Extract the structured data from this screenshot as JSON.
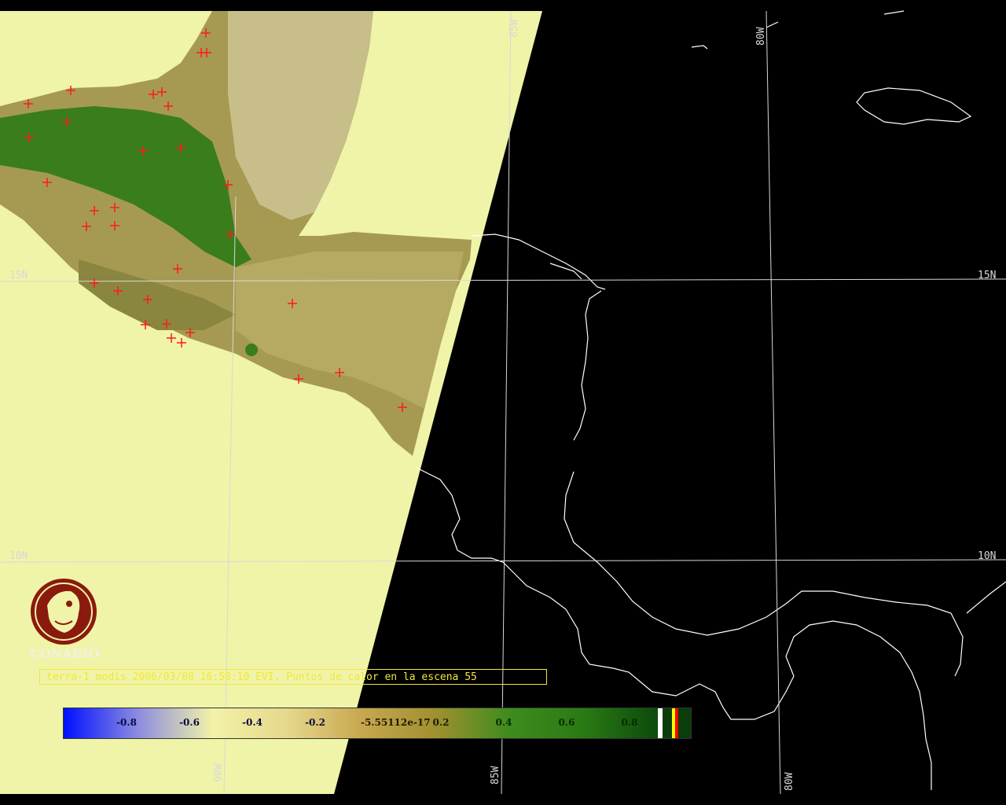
{
  "caption": "terra-1 modis 2006/03/08 16:58:10 EVI. Puntos de calor en la escena 55",
  "logo_text": "CONABIO",
  "grid_labels": {
    "lon_85_top": "85W",
    "lon_80_top": "80W",
    "lat_15_left": "15N",
    "lat_15_right": "15N",
    "lat_10_left": "10N",
    "lat_10_right": "10N",
    "lon_90_bottom": "90W",
    "lon_85_bottom": "85W",
    "lon_80_bottom": "80W"
  },
  "legend": {
    "labels": [
      "-0.8",
      "-0.6",
      "-0.4",
      "-0.2",
      "-5.55112e-17",
      "0.2",
      "0.4",
      "0.6",
      "0.8"
    ],
    "gradient_stops": [
      "#0010ff",
      "#8c8ce0",
      "#f2f2a8",
      "#e6d88c",
      "#c8a850",
      "#a09030",
      "#3e8c1e",
      "#2a7a14",
      "#0c4a0c"
    ],
    "extra_colors": [
      "#ffffff",
      "#0a3d0a",
      "#ffff00",
      "#ff0000",
      "#0a3d0a"
    ]
  },
  "colors": {
    "land_lit": "#f0f4a8",
    "night": "#000000",
    "grid": "#d8d8d8",
    "coast": "#ffffff",
    "hotspot": "#ff1a1a",
    "caption": "#f2e63a",
    "logo": "#8b1a0e"
  }
}
